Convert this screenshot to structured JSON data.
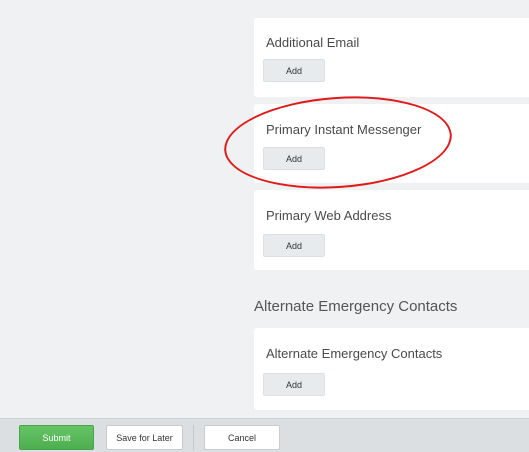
{
  "cards": {
    "additional_email": {
      "title": "Additional Email",
      "add_label": "Add"
    },
    "primary_instant_messenger": {
      "title": "Primary Instant Messenger",
      "add_label": "Add"
    },
    "primary_web_address": {
      "title": "Primary Web Address",
      "add_label": "Add"
    },
    "alternate_emergency_contacts": {
      "title": "Alternate Emergency Contacts",
      "add_label": "Add"
    }
  },
  "sections": {
    "alternate_emergency_contacts_heading": "Alternate Emergency Contacts"
  },
  "footer": {
    "submit_label": "Submit",
    "save_for_later_label": "Save for Later",
    "cancel_label": "Cancel"
  },
  "colors": {
    "background": "#f0f1f2",
    "card": "#ffffff",
    "submit_green": "#5cb85c",
    "annotation_red": "#e01a1a"
  }
}
